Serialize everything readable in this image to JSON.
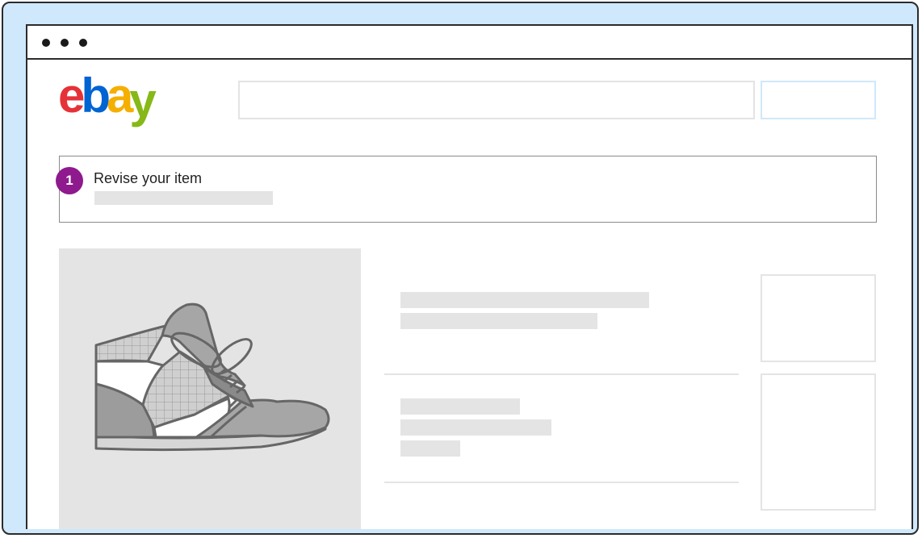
{
  "window": {
    "controls": [
      "dot",
      "dot",
      "dot"
    ]
  },
  "header": {
    "logo": {
      "letters": [
        {
          "char": "e",
          "color": "#e53238"
        },
        {
          "char": "b",
          "color": "#0064d2"
        },
        {
          "char": "a",
          "color": "#f5af02"
        },
        {
          "char": "y",
          "color": "#86b817"
        }
      ]
    },
    "search": {
      "placeholder": ""
    }
  },
  "step": {
    "number": "1",
    "label": "Revise your item",
    "badge_color": "#8e1a8e"
  },
  "listing": {
    "image_icon": "sneaker-icon"
  },
  "colors": {
    "frame_bg": "#cfe8fb",
    "placeholder": "#e4e4e4",
    "border": "#2b2b2b"
  }
}
